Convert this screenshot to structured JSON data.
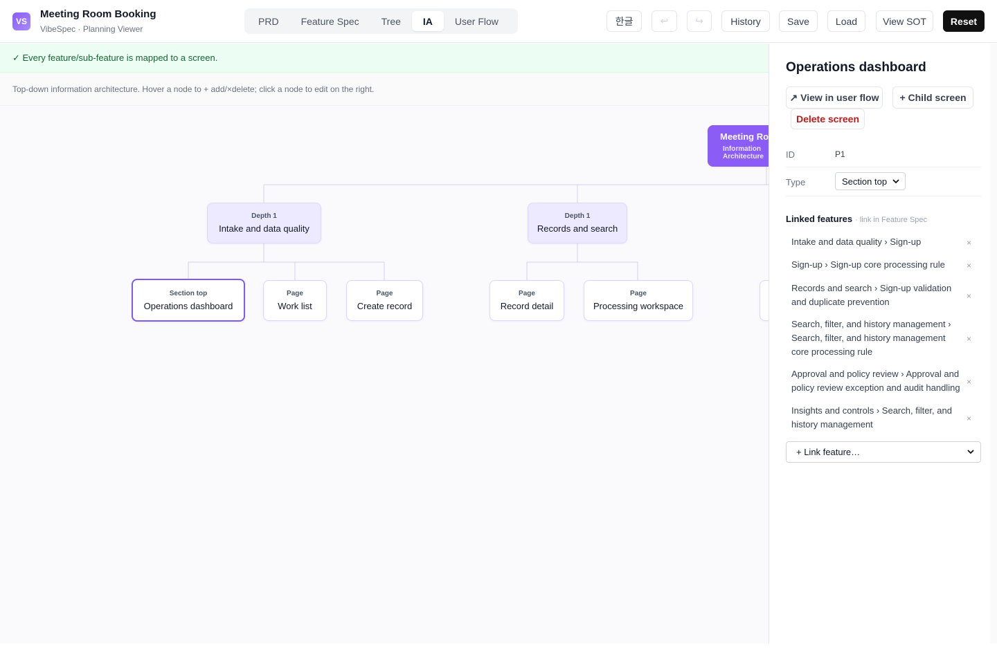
{
  "app": {
    "logo": "VS",
    "title": "Meeting Room Booking",
    "subtitle": "VibeSpec · Planning Viewer"
  },
  "tabs": [
    {
      "label": "PRD",
      "active": false
    },
    {
      "label": "Feature Spec",
      "active": false
    },
    {
      "label": "Tree",
      "active": false
    },
    {
      "label": "IA",
      "active": true
    },
    {
      "label": "User Flow",
      "active": false
    }
  ],
  "header_buttons": {
    "language": "한글",
    "undo": "↩",
    "redo": "↪",
    "history": "History",
    "save": "Save",
    "load": "Load",
    "view_sot": "View SOT",
    "reset": "Reset"
  },
  "banner": "✓ Every feature/sub-feature is mapped to a screen.",
  "hint": "Top-down information architecture. Hover a node to  + add/×delete; click a node to edit on the right.",
  "tree": {
    "root": {
      "title": "Meeting Room Booking",
      "label": "Information Architecture"
    },
    "depth1": [
      {
        "label": "Depth 1",
        "title": "Intake and data quality"
      },
      {
        "label": "Depth 1",
        "title": "Records and search"
      }
    ],
    "pages": [
      {
        "label": "Section top",
        "title": "Operations dashboard",
        "selected": true
      },
      {
        "label": "Page",
        "title": "Work list"
      },
      {
        "label": "Page",
        "title": "Create record"
      },
      {
        "label": "Page",
        "title": "Record detail"
      },
      {
        "label": "Page",
        "title": "Processing workspace"
      }
    ]
  },
  "panel": {
    "title": "Operations dashboard",
    "view_in_flow": "↗ View in user flow",
    "child_screen": "+ Child screen",
    "delete_screen": "Delete screen",
    "id_label": "ID",
    "id_value": "P1",
    "type_label": "Type",
    "type_value": "Section top",
    "linked_title": "Linked features",
    "linked_sub": "· link in Feature Spec",
    "features": [
      "Intake and data quality › Sign-up",
      "Sign-up › Sign-up core processing rule",
      "Records and search › Sign-up validation and duplicate prevention",
      "Search, filter, and history management › Search, filter, and history management core processing rule",
      "Approval and policy review › Approval and policy review exception and audit handling",
      "Insights and controls › Search, filter, and history management"
    ],
    "remove_glyph": "×",
    "link_feature": "+ Link feature…"
  },
  "colors": {
    "accent": "#8b5cf6",
    "selected_border": "#7c5cf0",
    "depth1_bg": "#ede9fe",
    "banner_bg": "#ecfdf3",
    "banner_text": "#166534",
    "danger": "#b91c1c"
  }
}
